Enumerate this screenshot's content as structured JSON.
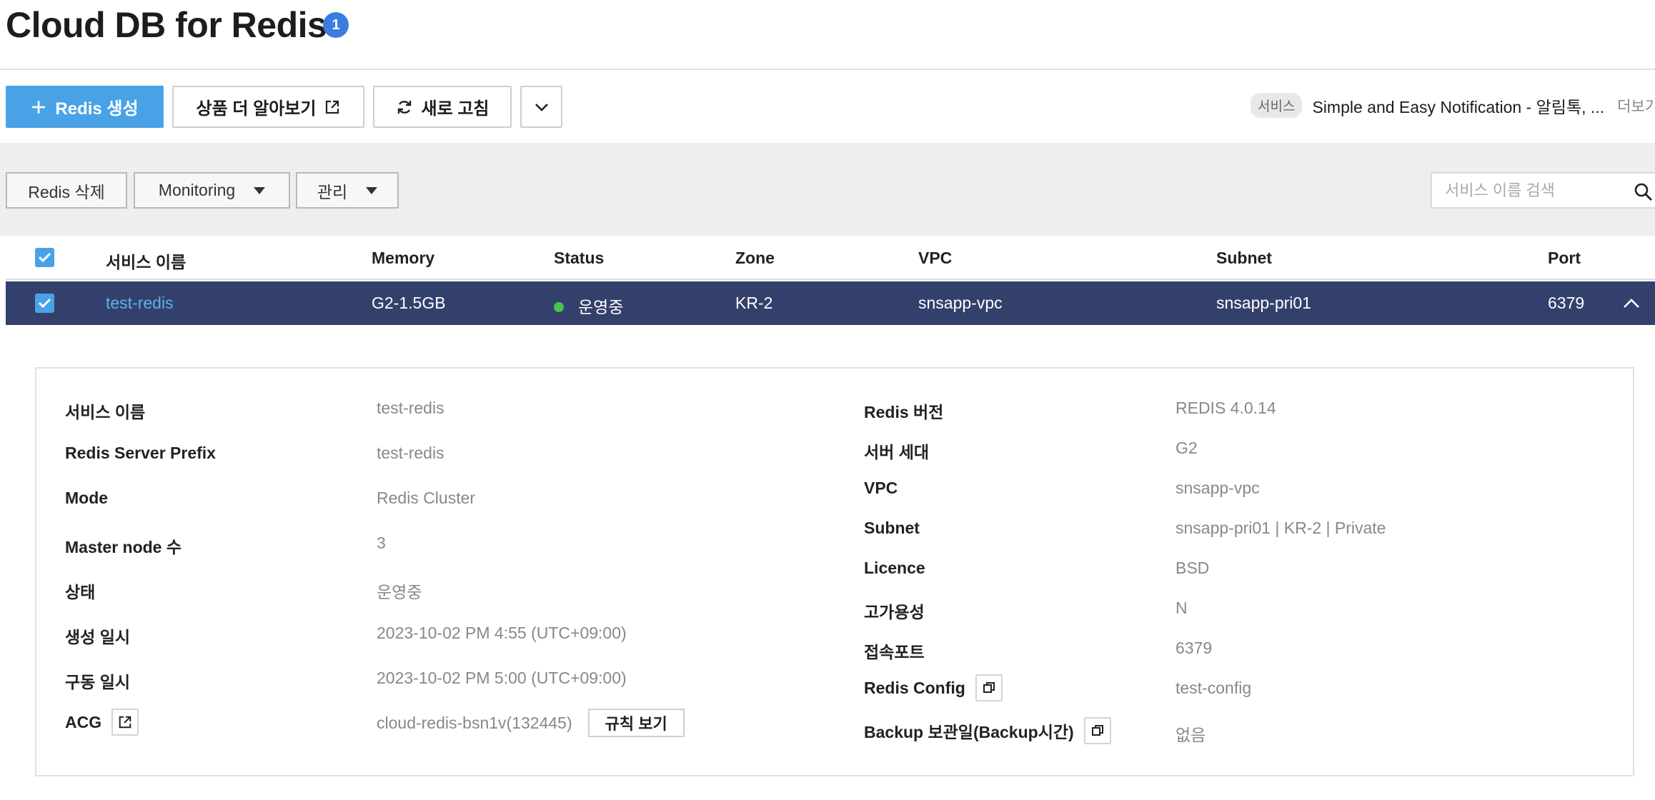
{
  "header": {
    "title": "Cloud DB for Redis",
    "badge": "1"
  },
  "actions": {
    "create_label": "Redis 생성",
    "more_info_label": "상품 더 알아보기",
    "refresh_label": "새로 고침",
    "service_tag": "서비스",
    "service_name": "Simple and Easy Notification - 알림톡, ...",
    "service_more": "더보기"
  },
  "filters": {
    "delete_label": "Redis 삭제",
    "monitoring_label": "Monitoring",
    "manage_label": "관리",
    "search_placeholder": "서비스 이름 검색"
  },
  "table": {
    "columns": [
      "서비스 이름",
      "Memory",
      "Status",
      "Zone",
      "VPC",
      "Subnet",
      "Port"
    ],
    "rows": [
      {
        "name": "test-redis",
        "memory": "G2-1.5GB",
        "status": "운영중",
        "zone": "KR-2",
        "vpc": "snsapp-vpc",
        "subnet": "snsapp-pri01",
        "port": "6379",
        "selected": true
      }
    ]
  },
  "detail": {
    "left": [
      {
        "label": "서비스 이름",
        "value": "test-redis"
      },
      {
        "label": "Redis Server Prefix",
        "value": "test-redis"
      },
      {
        "label": "Mode",
        "value": "Redis Cluster"
      },
      {
        "label": "Master node 수",
        "value": "3"
      },
      {
        "label": "상태",
        "value": "운영중"
      },
      {
        "label": "생성 일시",
        "value": "2023-10-02 PM 4:55 (UTC+09:00)"
      },
      {
        "label": "구동 일시",
        "value": "2023-10-02 PM 5:00 (UTC+09:00)"
      },
      {
        "label": "ACG",
        "value": "cloud-redis-bsn1v(132445)",
        "button": "규칙 보기"
      }
    ],
    "right": [
      {
        "label": "Redis 버전",
        "value": "REDIS 4.0.14"
      },
      {
        "label": "서버 세대",
        "value": "G2"
      },
      {
        "label": "VPC",
        "value": "snsapp-vpc"
      },
      {
        "label": "Subnet",
        "value": "snsapp-pri01 | KR-2 | Private"
      },
      {
        "label": "Licence",
        "value": "BSD"
      },
      {
        "label": "고가용성",
        "value": "N"
      },
      {
        "label": "접속포트",
        "value": "6379"
      },
      {
        "label": "Redis Config",
        "value": "test-config"
      },
      {
        "label": "Backup 보관일(Backup시간)",
        "value": "없음"
      }
    ]
  },
  "colors": {
    "primary": "#4aa2e6",
    "selected_row": "#34406c",
    "status_running": "#49c24f",
    "badge": "#3a7ce0"
  }
}
